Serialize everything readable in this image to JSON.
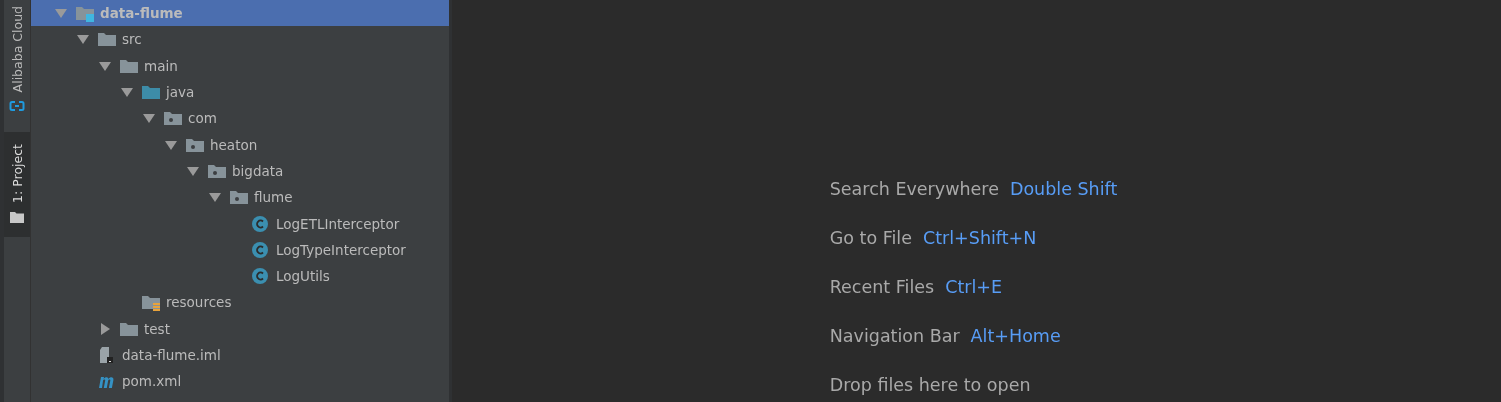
{
  "tool_stripe": [
    {
      "label": "Alibaba Cloud",
      "kind": "cloud",
      "selected": false
    },
    {
      "label": "1: Project",
      "kind": "project",
      "selected": true
    }
  ],
  "tree": [
    {
      "label": "data-flume",
      "kind": "module",
      "selected": true,
      "expanded": true,
      "children": [
        {
          "label": "src",
          "kind": "folder",
          "selected": false,
          "expanded": true,
          "children": [
            {
              "label": "main",
              "kind": "folder",
              "selected": false,
              "expanded": true,
              "children": [
                {
                  "label": "java",
                  "kind": "source",
                  "selected": false,
                  "expanded": true,
                  "children": [
                    {
                      "label": "com",
                      "kind": "package",
                      "selected": false,
                      "expanded": true,
                      "children": [
                        {
                          "label": "heaton",
                          "kind": "package",
                          "selected": false,
                          "expanded": true,
                          "children": [
                            {
                              "label": "bigdata",
                              "kind": "package",
                              "selected": false,
                              "expanded": true,
                              "children": [
                                {
                                  "label": "flume",
                                  "kind": "package",
                                  "selected": false,
                                  "expanded": true,
                                  "children": [
                                    {
                                      "label": "LogETLInterceptor",
                                      "kind": "class",
                                      "selected": false
                                    },
                                    {
                                      "label": "LogTypeInterceptor",
                                      "kind": "class",
                                      "selected": false
                                    },
                                    {
                                      "label": "LogUtils",
                                      "kind": "class",
                                      "selected": false
                                    }
                                  ]
                                }
                              ]
                            }
                          ]
                        }
                      ]
                    }
                  ]
                },
                {
                  "label": "resources",
                  "kind": "resources",
                  "selected": false
                }
              ]
            },
            {
              "label": "test",
              "kind": "folder",
              "selected": false,
              "expanded": false
            }
          ]
        },
        {
          "label": "data-flume.iml",
          "kind": "iml",
          "selected": false
        },
        {
          "label": "pom.xml",
          "kind": "pom",
          "selected": false
        }
      ]
    }
  ],
  "editor_hints": [
    {
      "label": "Search Everywhere",
      "shortcut": "Double Shift"
    },
    {
      "label": "Go to File",
      "shortcut": "Ctrl+Shift+N"
    },
    {
      "label": "Recent Files",
      "shortcut": "Ctrl+E"
    },
    {
      "label": "Navigation Bar",
      "shortcut": "Alt+Home"
    },
    {
      "label": "Drop files here to open"
    }
  ]
}
